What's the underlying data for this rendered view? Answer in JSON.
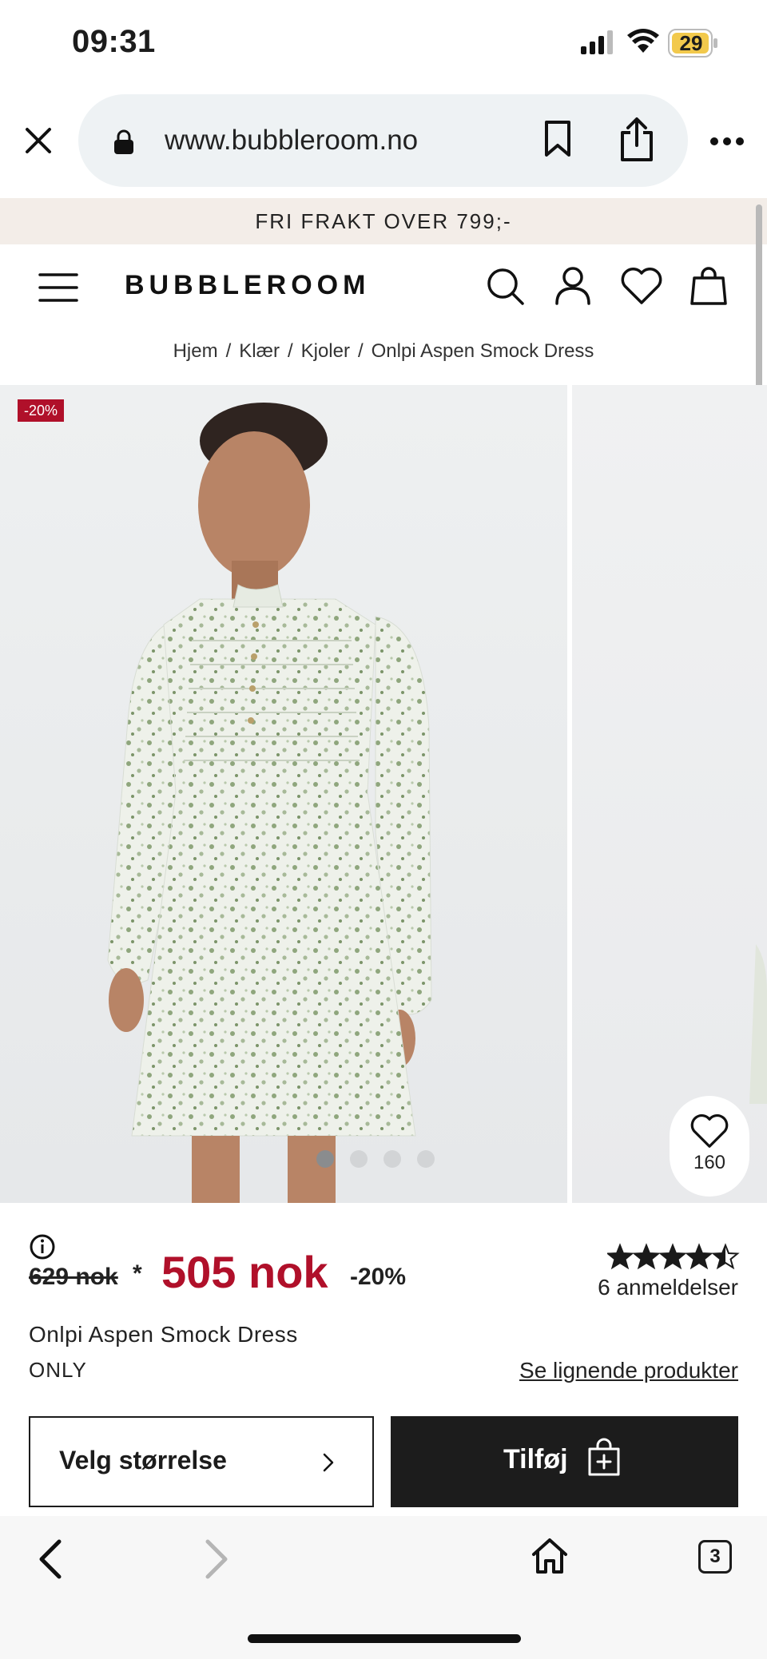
{
  "status_bar": {
    "time": "09:31",
    "battery": "29"
  },
  "browser": {
    "url": "www.bubbleroom.no",
    "tab_count": "3"
  },
  "promo": {
    "text": "FRI FRAKT OVER 799;-"
  },
  "header": {
    "logo": "BUBBLEROOM"
  },
  "breadcrumb": {
    "items": [
      "Hjem",
      "Klær",
      "Kjoler",
      "Onlpi Aspen Smock Dress"
    ],
    "separator": "/"
  },
  "gallery": {
    "badge": "-20%",
    "dots_total": 4,
    "active_dot": 0,
    "likes": "160"
  },
  "product": {
    "old_price": "629 nok",
    "asterisk": "*",
    "new_price": "505 nok",
    "discount": "-20%",
    "rating": 4.5,
    "reviews": "6 anmeldelser",
    "name": "Onlpi Aspen Smock Dress",
    "brand": "ONLY",
    "similar_link": "Se lignende produkter"
  },
  "actions": {
    "size_label": "Velg størrelse",
    "add_label": "Tilføj"
  },
  "colors": {
    "accent_red": "#b0102a",
    "dark": "#1c1c1c",
    "promo_bg": "#f3ede8"
  }
}
